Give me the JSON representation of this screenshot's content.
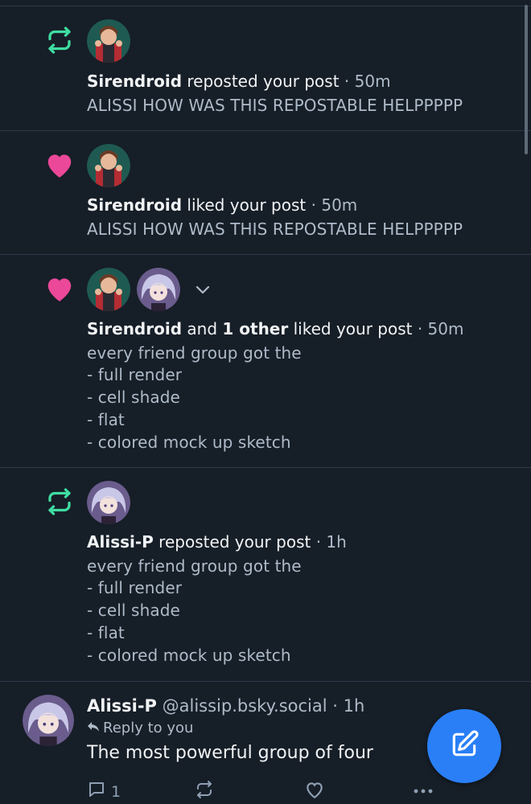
{
  "colors": {
    "background": "#161e27",
    "divider": "#2c3a4a",
    "repost_icon": "#3fdda2",
    "like_icon": "#ec4899",
    "secondary_text": "#aebbc9",
    "fab": "#2a7ff7"
  },
  "notifications": [
    {
      "type_icon": "repost-icon",
      "name": "Sirendroid",
      "verb": "reposted your post",
      "time": "· 50m",
      "post_text": "ALISSI HOW WAS THIS REPOSTABLE HELPPPPP"
    },
    {
      "type_icon": "heart-icon",
      "name": "Sirendroid",
      "verb": "liked your post",
      "time": "· 50m",
      "post_text": "ALISSI HOW WAS THIS REPOSTABLE HELPPPPP"
    },
    {
      "type_icon": "heart-icon",
      "name": "Sirendroid",
      "connector": "and",
      "others": "1 other",
      "verb": "liked your post",
      "time": "· 50m",
      "post_lines": [
        "every friend group got the",
        "- full render",
        "- cell shade",
        "- flat",
        "- colored mock up sketch"
      ]
    },
    {
      "type_icon": "repost-icon",
      "name": "Alissi-P",
      "verb": "reposted your post",
      "time": "· 1h",
      "post_lines": [
        "every friend group got the",
        "- full render",
        "- cell shade",
        "- flat",
        "- colored mock up sketch"
      ]
    }
  ],
  "reply": {
    "name": "Alissi-P",
    "handle": "@alissip.bsky.social",
    "time": "· 1h",
    "reply_to": "Reply to you",
    "text": "The most powerful group of four",
    "reply_count": "1"
  }
}
